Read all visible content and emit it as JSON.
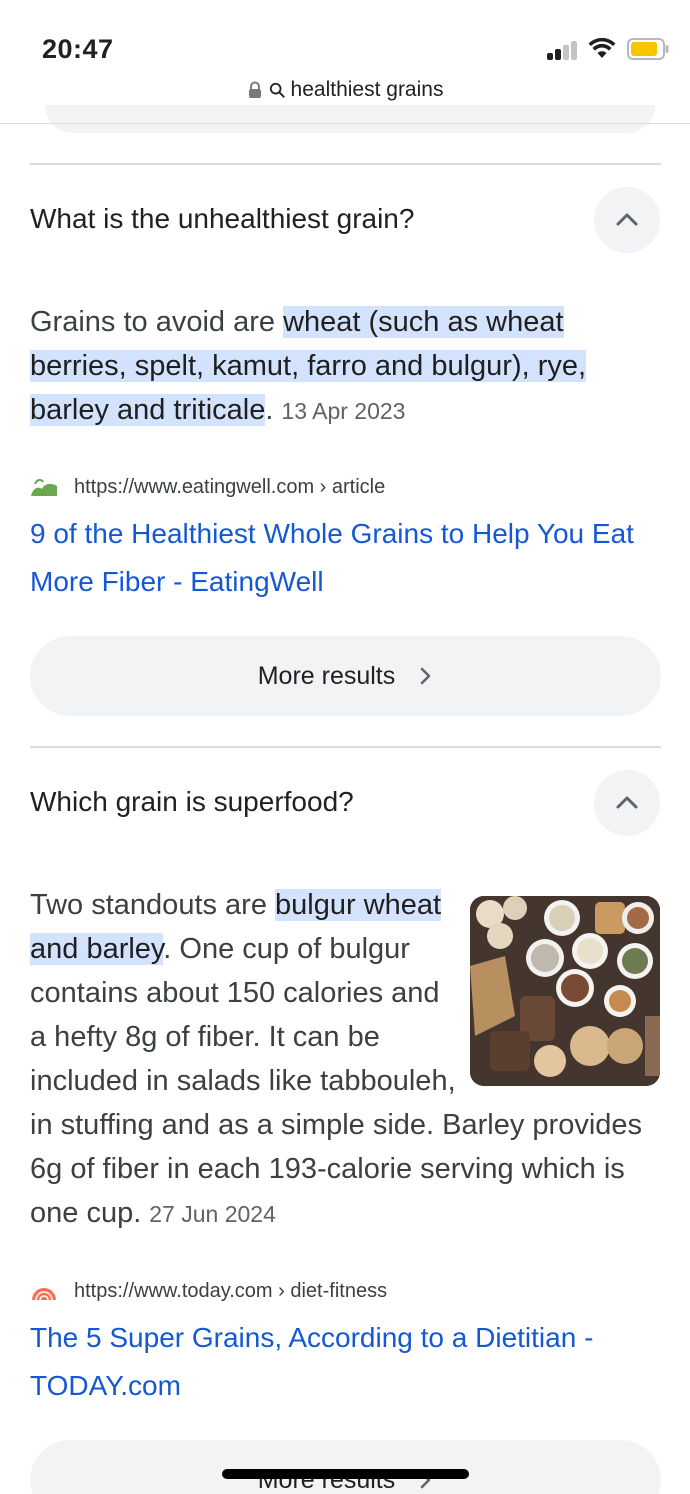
{
  "status_bar": {
    "time": "20:47"
  },
  "url_bar": {
    "query": "healthiest grains"
  },
  "faq1": {
    "question": "What is the unhealthiest grain?",
    "answer_prefix": "Grains to avoid are ",
    "answer_highlight": "wheat (such as wheat berries, spelt, kamut, farro and bulgur), rye, barley and triticale",
    "answer_suffix": ".",
    "date": "13 Apr 2023",
    "source_url": "https://www.eatingwell.com › article",
    "link_title": "9 of the Healthiest Whole Grains to Help You Eat More Fiber - EatingWell",
    "more_label": "More results"
  },
  "faq2": {
    "question": "Which grain is superfood?",
    "answer_prefix": "Two standouts are ",
    "answer_highlight": "bulgur wheat and barley",
    "answer_suffix": ". One cup of bulgur contains about 150 calories and a hefty 8g of fiber. It can be included in salads like tabbouleh, in stuffing and as a simple side. Barley provides 6g of fiber in each 193-calorie serving which is one cup.",
    "date": "27 Jun 2024",
    "source_url": "https://www.today.com › diet-fitness",
    "link_title": "The 5 Super Grains, According to a Dietitian - TODAY.com",
    "more_label": "More results"
  },
  "colors": {
    "highlight": "#d3e3fd",
    "link": "#1558d6",
    "button_bg": "#f1f3f4",
    "battery": "#f7c600"
  },
  "icons": {
    "signal": "signal-icon",
    "wifi": "wifi-icon",
    "battery": "battery-icon",
    "lock": "lock-icon",
    "search": "search-icon",
    "collapse": "chevron-up-icon",
    "more": "chevron-right-icon"
  }
}
